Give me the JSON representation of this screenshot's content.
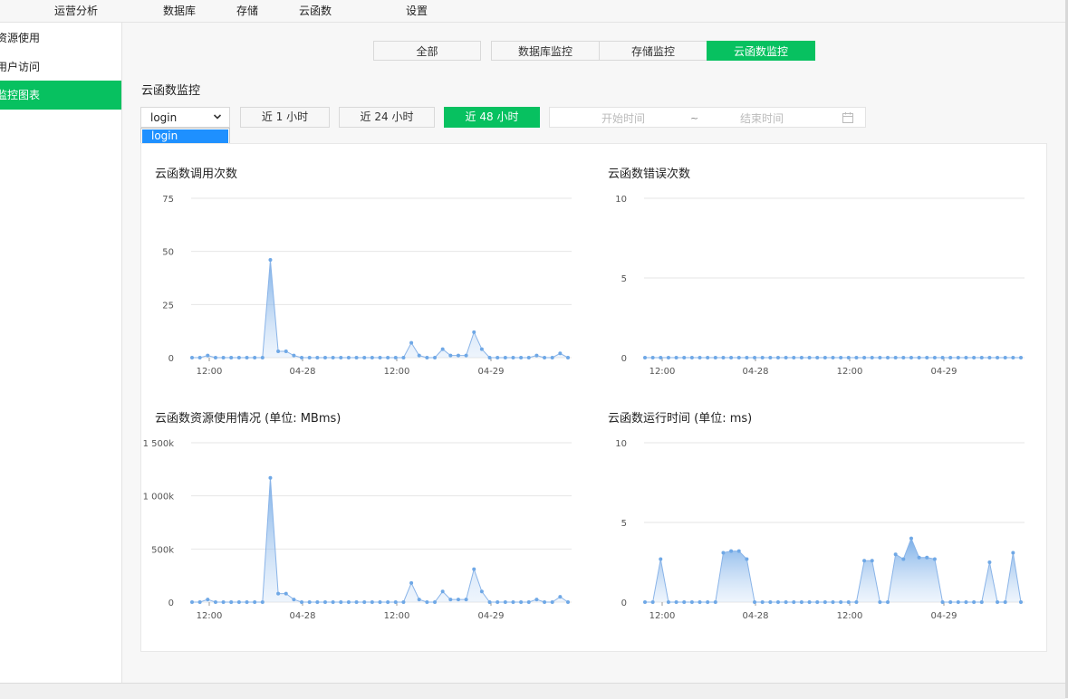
{
  "topnav": {
    "items": [
      {
        "label": "运营分析"
      },
      {
        "label": "数据库"
      },
      {
        "label": "存储"
      },
      {
        "label": "云函数"
      },
      {
        "label": "设置"
      }
    ]
  },
  "sidebar": {
    "items": [
      {
        "label": "资源使用"
      },
      {
        "label": "用户访问"
      },
      {
        "label": "监控图表",
        "active": true
      }
    ]
  },
  "tabs": [
    {
      "label": "全部"
    },
    {
      "label": "数据库监控"
    },
    {
      "label": "存储监控"
    },
    {
      "label": "云函数监控",
      "active": true
    }
  ],
  "section_title": "云函数监控",
  "function_select": {
    "value": "login",
    "options": [
      "login"
    ]
  },
  "range_buttons": [
    {
      "label": "近 1 小时"
    },
    {
      "label": "近 24 小时"
    },
    {
      "label": "近 48 小时",
      "active": true
    }
  ],
  "date_range": {
    "start_placeholder": "开始时间",
    "separator": "~",
    "end_placeholder": "结束时间"
  },
  "colors": {
    "accent": "#07c160",
    "series_line": "#8ab4e8",
    "series_point": "#6fa8e6",
    "grid": "#e6e6e6"
  },
  "chart_data": [
    {
      "type": "area",
      "title": "云函数调用次数",
      "x_tick_labels": [
        "12:00",
        "04-28",
        "12:00",
        "04-29"
      ],
      "y_tick_labels": [
        "0",
        "25",
        "50",
        "75"
      ],
      "ylim": [
        0,
        75
      ],
      "grid": true,
      "values": [
        0,
        0,
        1,
        0,
        0,
        0,
        0,
        0,
        0,
        0,
        46,
        3,
        3,
        1,
        0,
        0,
        0,
        0,
        0,
        0,
        0,
        0,
        0,
        0,
        0,
        0,
        0,
        0,
        7,
        1,
        0,
        0,
        4,
        1,
        1,
        1,
        12,
        4,
        0,
        0,
        0,
        0,
        0,
        0,
        1,
        0,
        0,
        2,
        0
      ]
    },
    {
      "type": "area",
      "title": "云函数错误次数",
      "x_tick_labels": [
        "12:00",
        "04-28",
        "12:00",
        "04-29"
      ],
      "y_tick_labels": [
        "0",
        "5",
        "10"
      ],
      "ylim": [
        0,
        10
      ],
      "grid": true,
      "values": [
        0,
        0,
        0,
        0,
        0,
        0,
        0,
        0,
        0,
        0,
        0,
        0,
        0,
        0,
        0,
        0,
        0,
        0,
        0,
        0,
        0,
        0,
        0,
        0,
        0,
        0,
        0,
        0,
        0,
        0,
        0,
        0,
        0,
        0,
        0,
        0,
        0,
        0,
        0,
        0,
        0,
        0,
        0,
        0,
        0,
        0,
        0,
        0,
        0
      ]
    },
    {
      "type": "area",
      "title": "云函数资源使用情况 (单位: MBms)",
      "x_tick_labels": [
        "12:00",
        "04-28",
        "12:00",
        "04-29"
      ],
      "y_tick_labels": [
        "0",
        "500k",
        "1 000k",
        "1 500k"
      ],
      "ylim": [
        0,
        1500000
      ],
      "grid": true,
      "values": [
        0,
        0,
        25000,
        0,
        0,
        0,
        0,
        0,
        0,
        0,
        1170000,
        80000,
        80000,
        25000,
        0,
        0,
        0,
        0,
        0,
        0,
        0,
        0,
        0,
        0,
        0,
        0,
        0,
        0,
        180000,
        25000,
        0,
        0,
        100000,
        25000,
        25000,
        25000,
        310000,
        100000,
        0,
        0,
        0,
        0,
        0,
        0,
        25000,
        0,
        0,
        50000,
        0
      ]
    },
    {
      "type": "area",
      "title": "云函数运行时间 (单位: ms)",
      "x_tick_labels": [
        "12:00",
        "04-28",
        "12:00",
        "04-29"
      ],
      "y_tick_labels": [
        "0",
        "5",
        "10"
      ],
      "ylim": [
        0,
        10
      ],
      "grid": true,
      "values": [
        0,
        0,
        2.7,
        0,
        0,
        0,
        0,
        0,
        0,
        0,
        3.1,
        3.2,
        3.2,
        2.7,
        0,
        0,
        0,
        0,
        0,
        0,
        0,
        0,
        0,
        0,
        0,
        0,
        0,
        0,
        2.6,
        2.6,
        0,
        0,
        3,
        2.7,
        4,
        2.8,
        2.8,
        2.7,
        0,
        0,
        0,
        0,
        0,
        0,
        2.5,
        0,
        0,
        3.1,
        0
      ]
    }
  ]
}
